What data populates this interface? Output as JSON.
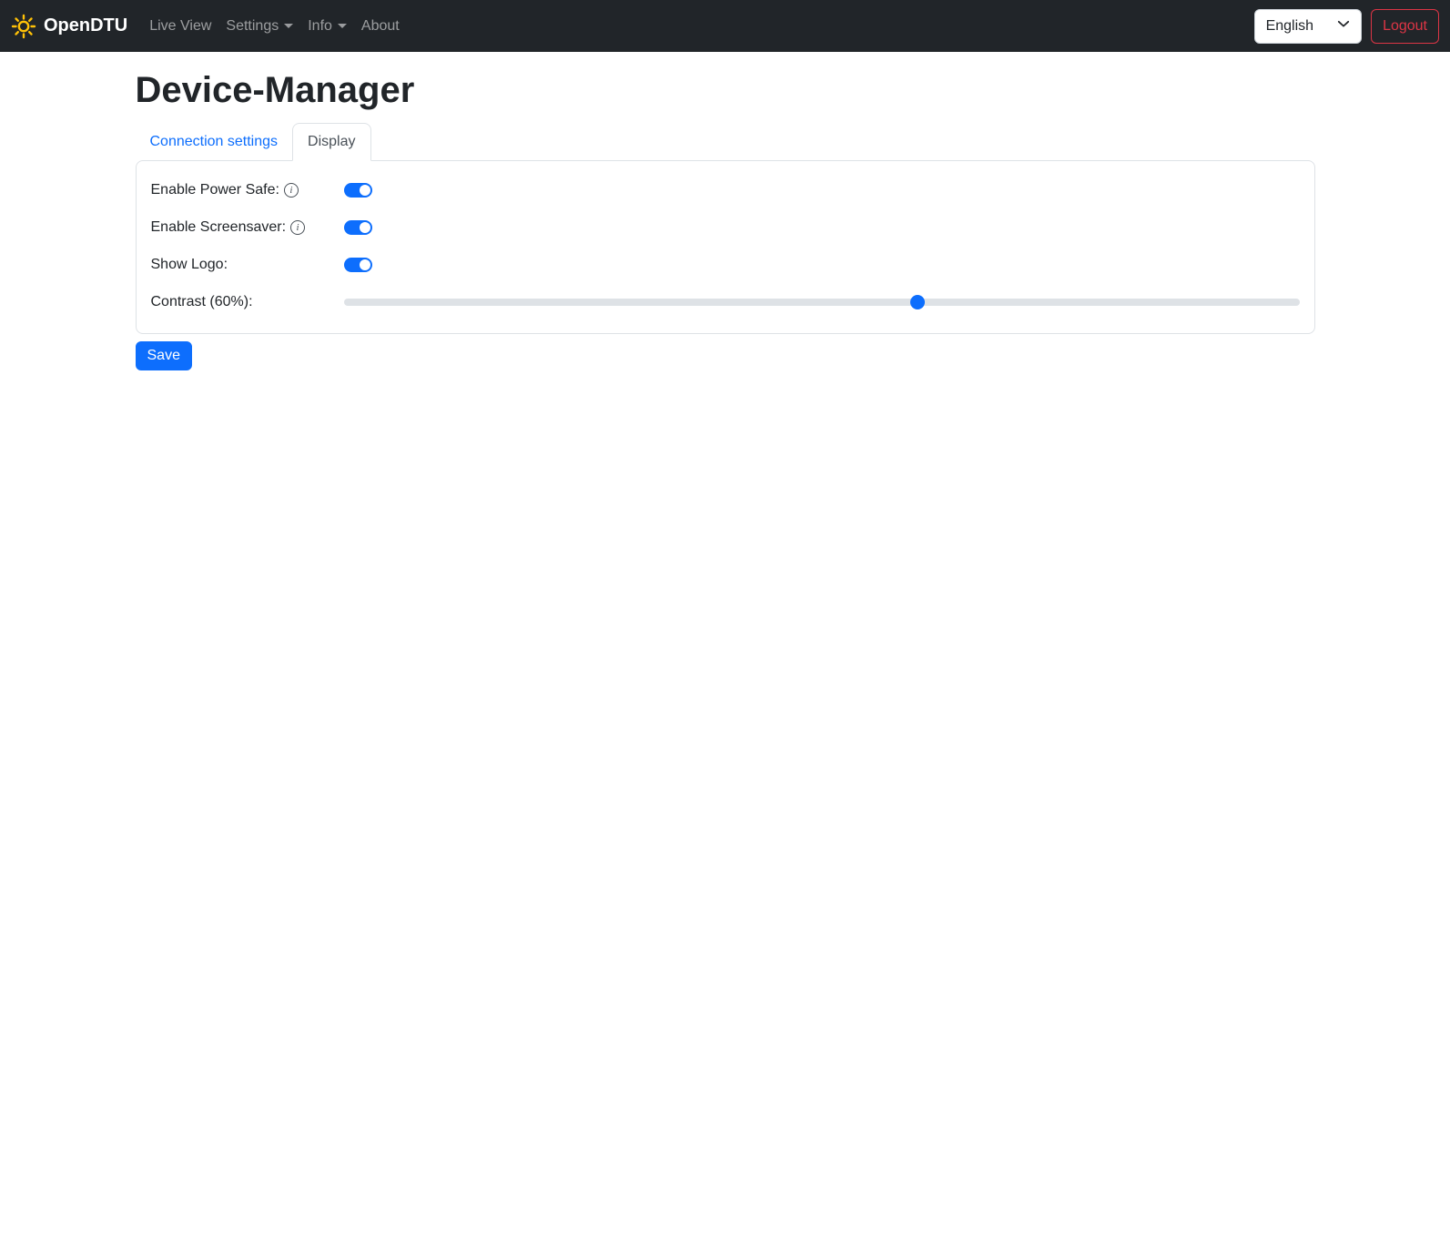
{
  "navbar": {
    "brand": "OpenDTU",
    "items": [
      {
        "label": "Live View",
        "dropdown": false
      },
      {
        "label": "Settings",
        "dropdown": true
      },
      {
        "label": "Info",
        "dropdown": true
      },
      {
        "label": "About",
        "dropdown": false
      }
    ],
    "language_selected": "English",
    "logout_label": "Logout"
  },
  "page": {
    "title": "Device-Manager"
  },
  "tabs": [
    {
      "label": "Connection settings",
      "active": false
    },
    {
      "label": "Display",
      "active": true
    }
  ],
  "form": {
    "rows": [
      {
        "label": "Enable Power Safe:",
        "control": "switch",
        "state": "on",
        "has_info": true
      },
      {
        "label": "Enable Screensaver:",
        "control": "switch",
        "state": "on",
        "has_info": true
      },
      {
        "label": "Show Logo:",
        "control": "switch",
        "state": "on",
        "has_info": false
      },
      {
        "label": "Contrast (60%):",
        "control": "slider",
        "value_percent": 60,
        "min": 0,
        "max": 100
      }
    ],
    "save_label": "Save"
  },
  "colors": {
    "accent": "#0d6efd",
    "navbar_bg": "#212529",
    "danger": "#dc3545",
    "brand_icon": "#ffc107",
    "card_border": "#dee2e6",
    "slider_track": "#dee2e6"
  }
}
